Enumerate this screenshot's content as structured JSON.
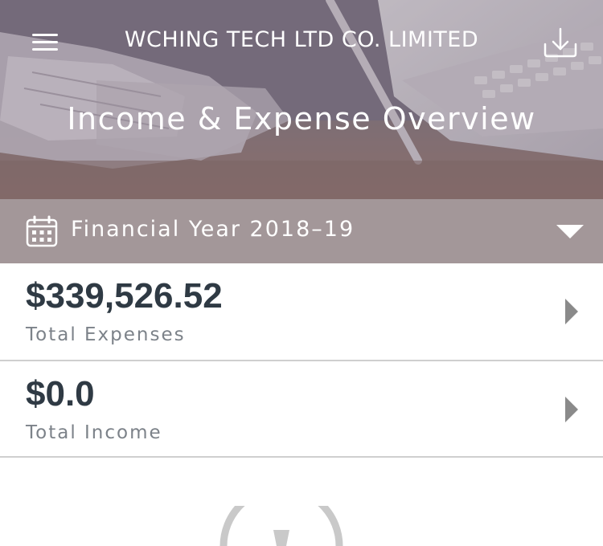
{
  "header": {
    "app_title": "WCHING TECH LTD CO. LIMITED",
    "page_title": "Income & Expense Overview",
    "menu_icon": "hamburger-menu-icon",
    "download_icon": "download-icon"
  },
  "period_selector": {
    "label": "Financial Year 2018–19",
    "icon": "calendar-icon",
    "dropdown_icon": "triangle-down-icon"
  },
  "summary": {
    "expenses": {
      "amount": "$339,526.52",
      "label": "Total Expenses"
    },
    "income": {
      "amount": "$0.0",
      "label": "Total Income"
    }
  },
  "colors": {
    "period_bar": "#a39799",
    "amount_text": "#2f3a44",
    "label_text": "#7c8289",
    "chevron": "#8a8a8a",
    "divider": "#cfcfcf"
  }
}
